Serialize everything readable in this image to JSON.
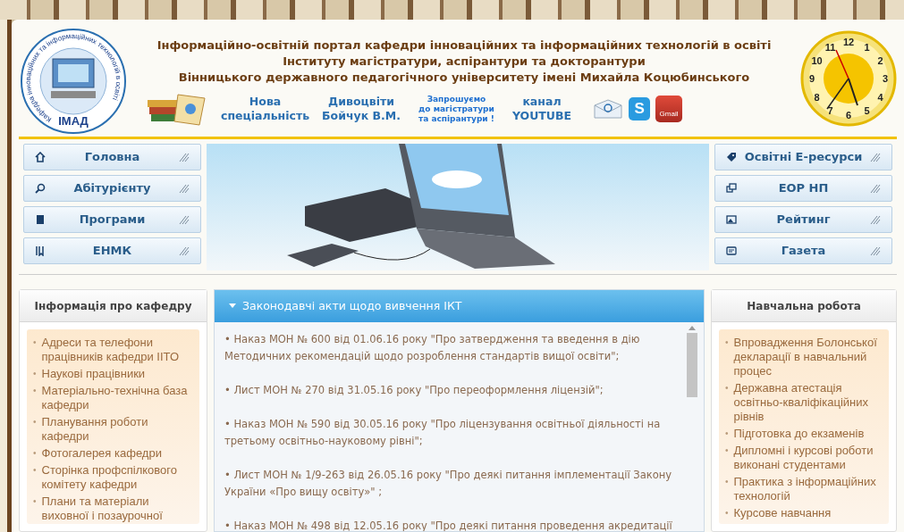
{
  "header": {
    "logo": {
      "ring_text": "Кафедра інноваційних та інформаційних технологій в освіті",
      "label": "ІМАД"
    },
    "title_lines": [
      "Інформаційно-освітній портал кафедри інноваційних та інформаційних технологій в освіті",
      "Інституту магістратури, аспірантури та докторантури",
      "Вінницького державного педагогічного університету імені Михайла Коцюбинського"
    ],
    "links": [
      {
        "kind": "text",
        "lines": [
          "Нова",
          "спеціальність"
        ]
      },
      {
        "kind": "text",
        "lines": [
          "Дивоцвіти",
          "Бойчук В.М."
        ]
      },
      {
        "kind": "small",
        "lines": [
          "Запрошуємо",
          "до магістратури",
          "та аспірантури !"
        ]
      },
      {
        "kind": "text",
        "lines": [
          "канал",
          "YOUTUBE"
        ]
      }
    ],
    "social": [
      {
        "kind": "email"
      },
      {
        "kind": "skype",
        "label": "S"
      },
      {
        "kind": "gmail",
        "label": "Gmail"
      }
    ],
    "clock": {
      "numbers": [
        "12",
        "1",
        "2",
        "3",
        "4",
        "5",
        "6",
        "7",
        "8",
        "9",
        "10",
        "11"
      ]
    }
  },
  "nav_left": [
    {
      "kind": "home",
      "label": "Головна"
    },
    {
      "kind": "search",
      "label": "Абітурієнту"
    },
    {
      "kind": "book",
      "label": "Програми"
    },
    {
      "kind": "bookmark",
      "label": "ЕНМК"
    }
  ],
  "nav_right": [
    {
      "kind": "tag",
      "label": "Освітні Е-ресурси"
    },
    {
      "kind": "windows",
      "label": "ЕОР НП"
    },
    {
      "kind": "image",
      "label": "Рейтинг"
    },
    {
      "kind": "card",
      "label": "Газета"
    }
  ],
  "left_column": {
    "title": "Інформація про кафедру",
    "bullet": "•",
    "items": [
      "Адреси та телефони працівників кафедри ІІТО",
      "Наукові працівники",
      "Матеріально-технічна база кафедри",
      "Планування роботи кафедри",
      "Фотогалерея кафедри",
      "Сторінка профспілкового комітету кафедри",
      "Плани та матеріали виховної і позаурочної"
    ]
  },
  "center_column": {
    "title": "Законодавчі акти щодо вивчення ІКТ",
    "items": [
      "• Наказ МОН № 600 від 01.06.16 року \"Про затвердження та введення в дію Методичних рекомендацій щодо розроблення стандартів вищої освіти\";",
      "• Лист МОН № 270 від 31.05.16 року \"Про переоформлення ліцензій\";",
      "• Наказ МОН № 590 від 30.05.16 року \"Про ліцензування освітньої діяльності на третьому освітньо-науковому рівні\";",
      "• Лист МОН № 1/9-263 від 26.05.16 року \"Про деякі питання імплементації Закону України «Про вищу освіту»\" ;",
      "• Наказ МОН № 498 від 12.05.16 року \"Про деякі питання проведення акредитації"
    ]
  },
  "right_column": {
    "title": "Навчальна робота",
    "bullet": "•",
    "items": [
      "Впровадження Болонської декларації в навчальний процес",
      "Державна атестація освітньо-кваліфікаційних рівнів",
      "Підготовка до екзаменів",
      "Дипломні і курсові роботи виконані студентами",
      "Практика з інформаційних технологій",
      "Курсове навчання"
    ]
  }
}
